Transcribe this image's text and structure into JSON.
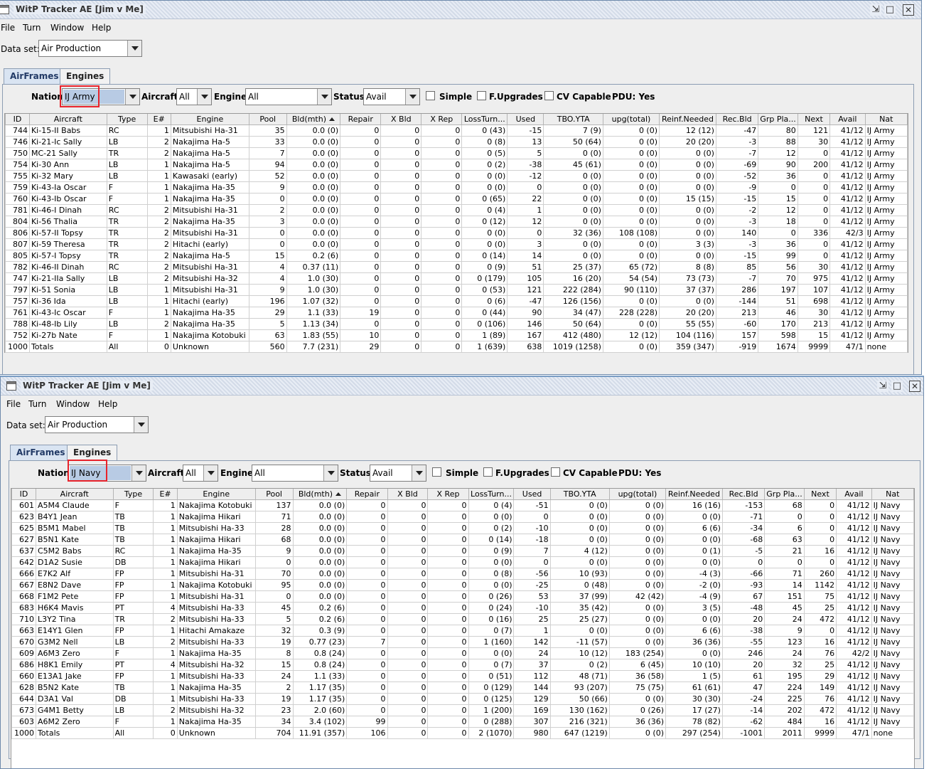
{
  "windows": [
    {
      "title": "WitP Tracker AE [Jim v Me]",
      "menus": [
        "File",
        "Turn",
        "Window",
        "Help"
      ],
      "dataset_label": "Data set:",
      "dataset_value": "Air Production",
      "tabs": [
        "AirFrames",
        "Engines"
      ],
      "filters": {
        "nation_label": "Nation:",
        "nation_value": "IJ Army",
        "aircraft_label": "Aircraft:",
        "aircraft_value": "All",
        "engine_label": "Engine:",
        "engine_value": "All",
        "status_label": "Status:",
        "status_value": "Avail",
        "simple": "Simple",
        "fupgrades": "F.Upgrades",
        "cvcapable": "CV Capable",
        "pdu": "PDU: Yes"
      },
      "columns": [
        "ID",
        "Aircraft",
        "Type",
        "E#",
        "Engine",
        "Pool",
        "Bld(mth)",
        "Repair",
        "X Bld",
        "X Rep",
        "LossTurn...",
        "Used",
        "TBO.YTA",
        "upg(total)",
        "Reinf.Needed",
        "Rec.Bld",
        "Grp Pla...",
        "Next",
        "Avail",
        "Nat"
      ],
      "rows": [
        [
          "744",
          "Ki-15-II Babs",
          "RC",
          "1",
          "Mitsubishi Ha-31",
          "35",
          "0.0 (0)",
          "0",
          "0",
          "0",
          "0 (43)",
          "-15",
          "7 (9)",
          "0 (0)",
          "12 (12)",
          "-47",
          "80",
          "121",
          "41/12",
          "IJ Army"
        ],
        [
          "746",
          "Ki-21-Ic Sally",
          "LB",
          "2",
          "Nakajima Ha-5",
          "33",
          "0.0 (0)",
          "0",
          "0",
          "0",
          "0 (8)",
          "13",
          "50 (64)",
          "0 (0)",
          "20 (20)",
          "-3",
          "88",
          "30",
          "41/12",
          "IJ Army"
        ],
        [
          "750",
          "MC-21 Sally",
          "TR",
          "2",
          "Nakajima Ha-5",
          "7",
          "0.0 (0)",
          "0",
          "0",
          "0",
          "0 (5)",
          "5",
          "0 (0)",
          "0 (0)",
          "0 (0)",
          "-7",
          "12",
          "0",
          "41/12",
          "IJ Army"
        ],
        [
          "754",
          "Ki-30 Ann",
          "LB",
          "1",
          "Nakajima Ha-5",
          "94",
          "0.0 (0)",
          "0",
          "0",
          "0",
          "0 (2)",
          "-38",
          "45 (61)",
          "0 (0)",
          "0 (0)",
          "-69",
          "90",
          "200",
          "41/12",
          "IJ Army"
        ],
        [
          "755",
          "Ki-32 Mary",
          "LB",
          "1",
          "Kawasaki (early)",
          "52",
          "0.0 (0)",
          "0",
          "0",
          "0",
          "0 (0)",
          "-12",
          "0 (0)",
          "0 (0)",
          "0 (0)",
          "-52",
          "36",
          "0",
          "41/12",
          "IJ Army"
        ],
        [
          "759",
          "Ki-43-Ia Oscar",
          "F",
          "1",
          "Nakajima Ha-35",
          "9",
          "0.0 (0)",
          "0",
          "0",
          "0",
          "0 (0)",
          "0",
          "0 (0)",
          "0 (0)",
          "0 (0)",
          "-9",
          "0",
          "0",
          "41/12",
          "IJ Army"
        ],
        [
          "760",
          "Ki-43-Ib Oscar",
          "F",
          "1",
          "Nakajima Ha-35",
          "0",
          "0.0 (0)",
          "0",
          "0",
          "0",
          "0 (65)",
          "22",
          "0 (0)",
          "0 (0)",
          "15 (15)",
          "-15",
          "15",
          "0",
          "41/12",
          "IJ Army"
        ],
        [
          "781",
          "Ki-46-I Dinah",
          "RC",
          "2",
          "Mitsubishi Ha-31",
          "2",
          "0.0 (0)",
          "0",
          "0",
          "0",
          "0 (4)",
          "1",
          "0 (0)",
          "0 (0)",
          "0 (0)",
          "-2",
          "12",
          "0",
          "41/12",
          "IJ Army"
        ],
        [
          "804",
          "Ki-56 Thalia",
          "TR",
          "2",
          "Nakajima Ha-35",
          "3",
          "0.0 (0)",
          "0",
          "0",
          "0",
          "0 (12)",
          "12",
          "0 (0)",
          "0 (0)",
          "0 (0)",
          "-3",
          "18",
          "0",
          "41/12",
          "IJ Army"
        ],
        [
          "806",
          "Ki-57-II Topsy",
          "TR",
          "2",
          "Mitsubishi Ha-31",
          "0",
          "0.0 (0)",
          "0",
          "0",
          "0",
          "0 (0)",
          "0",
          "32 (36)",
          "108 (108)",
          "0 (0)",
          "140",
          "0",
          "336",
          "42/3",
          "IJ Army"
        ],
        [
          "807",
          "Ki-59 Theresa",
          "TR",
          "2",
          "Hitachi (early)",
          "0",
          "0.0 (0)",
          "0",
          "0",
          "0",
          "0 (0)",
          "3",
          "0 (0)",
          "0 (0)",
          "3 (3)",
          "-3",
          "36",
          "0",
          "41/12",
          "IJ Army"
        ],
        [
          "805",
          "Ki-57-I Topsy",
          "TR",
          "2",
          "Nakajima Ha-5",
          "15",
          "0.2 (6)",
          "0",
          "0",
          "0",
          "0 (14)",
          "14",
          "0 (0)",
          "0 (0)",
          "0 (0)",
          "-15",
          "99",
          "0",
          "41/12",
          "IJ Army"
        ],
        [
          "782",
          "Ki-46-II Dinah",
          "RC",
          "2",
          "Mitsubishi Ha-31",
          "4",
          "0.37 (11)",
          "0",
          "0",
          "0",
          "0 (9)",
          "51",
          "25 (37)",
          "65 (72)",
          "8 (8)",
          "85",
          "56",
          "30",
          "41/12",
          "IJ Army"
        ],
        [
          "747",
          "Ki-21-IIa Sally",
          "LB",
          "2",
          "Mitsubishi Ha-32",
          "4",
          "1.0 (30)",
          "0",
          "0",
          "0",
          "0 (179)",
          "105",
          "16 (20)",
          "54 (54)",
          "73 (73)",
          "-7",
          "70",
          "975",
          "41/12",
          "IJ Army"
        ],
        [
          "797",
          "Ki-51 Sonia",
          "LB",
          "1",
          "Mitsubishi Ha-31",
          "9",
          "1.0 (30)",
          "0",
          "0",
          "0",
          "0 (53)",
          "121",
          "222 (284)",
          "90 (110)",
          "37 (37)",
          "286",
          "197",
          "107",
          "41/12",
          "IJ Army"
        ],
        [
          "757",
          "Ki-36 Ida",
          "LB",
          "1",
          "Hitachi (early)",
          "196",
          "1.07 (32)",
          "0",
          "0",
          "0",
          "0 (6)",
          "-47",
          "126 (156)",
          "0 (0)",
          "0 (0)",
          "-144",
          "51",
          "698",
          "41/12",
          "IJ Army"
        ],
        [
          "761",
          "Ki-43-Ic Oscar",
          "F",
          "1",
          "Nakajima Ha-35",
          "29",
          "1.1 (33)",
          "19",
          "0",
          "0",
          "0 (44)",
          "90",
          "34 (47)",
          "228 (228)",
          "20 (20)",
          "213",
          "46",
          "30",
          "41/12",
          "IJ Army"
        ],
        [
          "788",
          "Ki-48-Ib Lily",
          "LB",
          "2",
          "Nakajima Ha-35",
          "5",
          "1.13 (34)",
          "0",
          "0",
          "0",
          "0 (106)",
          "146",
          "50 (64)",
          "0 (0)",
          "55 (55)",
          "-60",
          "170",
          "213",
          "41/12",
          "IJ Army"
        ],
        [
          "752",
          "Ki-27b Nate",
          "F",
          "1",
          "Nakajima Kotobuki",
          "63",
          "1.83 (55)",
          "10",
          "0",
          "0",
          "1 (89)",
          "167",
          "412 (480)",
          "12 (12)",
          "104 (116)",
          "157",
          "598",
          "15",
          "41/12",
          "IJ Army"
        ],
        [
          "1000",
          "Totals",
          "All",
          "0",
          "Unknown",
          "560",
          "7.7 (231)",
          "29",
          "0",
          "0",
          "1 (639)",
          "638",
          "1019 (1258)",
          "0 (0)",
          "359 (347)",
          "-919",
          "1674",
          "9999",
          "47/1",
          "none"
        ]
      ]
    },
    {
      "title": "WitP Tracker AE [Jim v Me]",
      "menus": [
        "File",
        "Turn",
        "Window",
        "Help"
      ],
      "dataset_label": "Data set:",
      "dataset_value": "Air Production",
      "tabs": [
        "AirFrames",
        "Engines"
      ],
      "filters": {
        "nation_label": "Nation:",
        "nation_value": "IJ Navy",
        "aircraft_label": "Aircraft:",
        "aircraft_value": "All",
        "engine_label": "Engine:",
        "engine_value": "All",
        "status_label": "Status:",
        "status_value": "Avail",
        "simple": "Simple",
        "fupgrades": "F.Upgrades",
        "cvcapable": "CV Capable",
        "pdu": "PDU: Yes"
      },
      "columns": [
        "ID",
        "Aircraft",
        "Type",
        "E#",
        "Engine",
        "Pool",
        "Bld(mth)",
        "Repair",
        "X Bld",
        "X Rep",
        "LossTurn...",
        "Used",
        "TBO.YTA",
        "upg(total)",
        "Reinf.Needed",
        "Rec.Bld",
        "Grp Pla...",
        "Next",
        "Avail",
        "Nat"
      ],
      "rows": [
        [
          "601",
          "A5M4 Claude",
          "F",
          "1",
          "Nakajima Kotobuki",
          "137",
          "0.0 (0)",
          "0",
          "0",
          "0",
          "0 (4)",
          "-51",
          "0 (0)",
          "0 (0)",
          "16 (16)",
          "-153",
          "68",
          "0",
          "41/12",
          "IJ Navy"
        ],
        [
          "623",
          "B4Y1 Jean",
          "TB",
          "1",
          "Nakajima Hikari",
          "71",
          "0.0 (0)",
          "0",
          "0",
          "0",
          "0 (0)",
          "0",
          "0 (0)",
          "0 (0)",
          "0 (0)",
          "-71",
          "0",
          "0",
          "41/12",
          "IJ Navy"
        ],
        [
          "625",
          "B5M1 Mabel",
          "TB",
          "1",
          "Mitsubishi Ha-33",
          "28",
          "0.0 (0)",
          "0",
          "0",
          "0",
          "0 (2)",
          "-10",
          "0 (0)",
          "0 (0)",
          "6 (6)",
          "-34",
          "6",
          "0",
          "41/12",
          "IJ Navy"
        ],
        [
          "627",
          "B5N1 Kate",
          "TB",
          "1",
          "Nakajima Hikari",
          "68",
          "0.0 (0)",
          "0",
          "0",
          "0",
          "0 (14)",
          "-18",
          "0 (0)",
          "0 (0)",
          "0 (0)",
          "-68",
          "63",
          "0",
          "41/12",
          "IJ Navy"
        ],
        [
          "637",
          "C5M2 Babs",
          "RC",
          "1",
          "Nakajima Ha-35",
          "9",
          "0.0 (0)",
          "0",
          "0",
          "0",
          "0 (9)",
          "7",
          "4 (12)",
          "0 (0)",
          "0 (1)",
          "-5",
          "21",
          "16",
          "41/12",
          "IJ Navy"
        ],
        [
          "642",
          "D1A2 Susie",
          "DB",
          "1",
          "Nakajima Hikari",
          "0",
          "0.0 (0)",
          "0",
          "0",
          "0",
          "0 (0)",
          "0",
          "0 (0)",
          "0 (0)",
          "0 (0)",
          "0",
          "0",
          "0",
          "41/12",
          "IJ Navy"
        ],
        [
          "666",
          "E7K2 Alf",
          "FP",
          "1",
          "Mitsubishi Ha-31",
          "70",
          "0.0 (0)",
          "0",
          "0",
          "0",
          "0 (8)",
          "-56",
          "10 (93)",
          "0 (0)",
          "-4 (3)",
          "-66",
          "71",
          "260",
          "41/12",
          "IJ Navy"
        ],
        [
          "667",
          "E8N2 Dave",
          "FP",
          "1",
          "Nakajima Kotobuki",
          "95",
          "0.0 (0)",
          "0",
          "0",
          "0",
          "0 (0)",
          "-25",
          "0 (48)",
          "0 (0)",
          "-2 (0)",
          "-93",
          "14",
          "1142",
          "41/12",
          "IJ Navy"
        ],
        [
          "668",
          "F1M2 Pete",
          "FP",
          "1",
          "Mitsubishi Ha-31",
          "0",
          "0.0 (0)",
          "0",
          "0",
          "0",
          "0 (26)",
          "53",
          "37 (99)",
          "42 (42)",
          "-4 (9)",
          "67",
          "151",
          "75",
          "41/12",
          "IJ Navy"
        ],
        [
          "683",
          "H6K4 Mavis",
          "PT",
          "4",
          "Mitsubishi Ha-33",
          "45",
          "0.2 (6)",
          "0",
          "0",
          "0",
          "0 (24)",
          "-10",
          "35 (42)",
          "0 (0)",
          "3 (5)",
          "-48",
          "45",
          "25",
          "41/12",
          "IJ Navy"
        ],
        [
          "710",
          "L3Y2 Tina",
          "TR",
          "2",
          "Mitsubishi Ha-33",
          "5",
          "0.2 (6)",
          "0",
          "0",
          "0",
          "0 (16)",
          "25",
          "25 (27)",
          "0 (0)",
          "0 (0)",
          "20",
          "24",
          "472",
          "41/12",
          "IJ Navy"
        ],
        [
          "663",
          "E14Y1 Glen",
          "FP",
          "1",
          "Hitachi Amakaze",
          "32",
          "0.3 (9)",
          "0",
          "0",
          "0",
          "0 (7)",
          "1",
          "0 (0)",
          "0 (0)",
          "6 (6)",
          "-38",
          "9",
          "0",
          "41/12",
          "IJ Navy"
        ],
        [
          "670",
          "G3M2 Nell",
          "LB",
          "2",
          "Mitsubishi Ha-33",
          "19",
          "0.77 (23)",
          "7",
          "0",
          "0",
          "1 (160)",
          "142",
          "-11 (57)",
          "0 (0)",
          "36 (36)",
          "-55",
          "123",
          "16",
          "41/12",
          "IJ Navy"
        ],
        [
          "609",
          "A6M3 Zero",
          "F",
          "1",
          "Nakajima Ha-35",
          "8",
          "0.8 (24)",
          "0",
          "0",
          "0",
          "0 (0)",
          "24",
          "10 (12)",
          "183 (254)",
          "0 (0)",
          "246",
          "24",
          "76",
          "42/2",
          "IJ Navy"
        ],
        [
          "686",
          "H8K1 Emily",
          "PT",
          "4",
          "Mitsubishi Ha-32",
          "15",
          "0.8 (24)",
          "0",
          "0",
          "0",
          "0 (7)",
          "37",
          "0 (2)",
          "6 (45)",
          "10 (10)",
          "20",
          "32",
          "25",
          "41/12",
          "IJ Navy"
        ],
        [
          "660",
          "E13A1 Jake",
          "FP",
          "1",
          "Mitsubishi Ha-33",
          "24",
          "1.1 (33)",
          "0",
          "0",
          "0",
          "0 (51)",
          "112",
          "48 (71)",
          "36 (58)",
          "1 (5)",
          "61",
          "195",
          "29",
          "41/12",
          "IJ Navy"
        ],
        [
          "628",
          "B5N2 Kate",
          "TB",
          "1",
          "Nakajima Ha-35",
          "2",
          "1.17 (35)",
          "0",
          "0",
          "0",
          "0 (129)",
          "144",
          "93 (207)",
          "75 (75)",
          "61 (61)",
          "47",
          "224",
          "149",
          "41/12",
          "IJ Navy"
        ],
        [
          "644",
          "D3A1 Val",
          "DB",
          "1",
          "Mitsubishi Ha-33",
          "19",
          "1.17 (35)",
          "0",
          "0",
          "0",
          "0 (125)",
          "129",
          "50 (66)",
          "0 (0)",
          "30 (30)",
          "-24",
          "225",
          "76",
          "41/12",
          "IJ Navy"
        ],
        [
          "673",
          "G4M1 Betty",
          "LB",
          "2",
          "Mitsubishi Ha-32",
          "23",
          "2.0 (60)",
          "0",
          "0",
          "0",
          "1 (200)",
          "169",
          "130 (162)",
          "0 (26)",
          "17 (27)",
          "-14",
          "202",
          "472",
          "41/12",
          "IJ Navy"
        ],
        [
          "603",
          "A6M2 Zero",
          "F",
          "1",
          "Nakajima Ha-35",
          "34",
          "3.4 (102)",
          "99",
          "0",
          "0",
          "0 (288)",
          "307",
          "216 (321)",
          "36 (36)",
          "78 (82)",
          "-62",
          "484",
          "16",
          "41/12",
          "IJ Navy"
        ],
        [
          "1000",
          "Totals",
          "All",
          "0",
          "Unknown",
          "704",
          "11.91 (357)",
          "106",
          "0",
          "0",
          "2 (1070)",
          "980",
          "647 (1219)",
          "0 (0)",
          "297 (254)",
          "-1001",
          "2011",
          "9999",
          "47/1",
          "none"
        ]
      ]
    }
  ]
}
